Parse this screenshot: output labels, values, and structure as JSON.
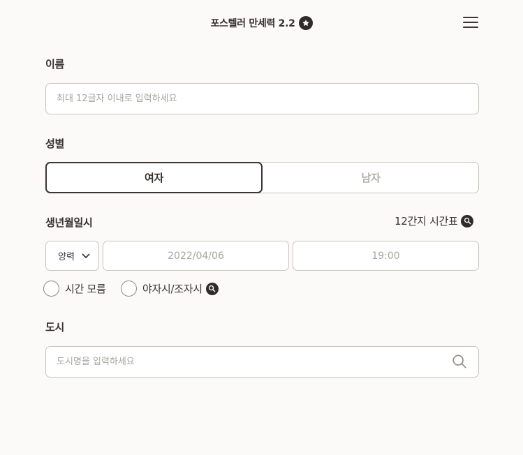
{
  "header": {
    "title": "포스텔러 만세력 2.2"
  },
  "name_field": {
    "label": "이름",
    "placeholder": "최대 12글자 이내로 입력하세요",
    "value": ""
  },
  "gender": {
    "label": "성별",
    "options": [
      "여자",
      "남자"
    ],
    "selected": "여자"
  },
  "birth": {
    "label": "생년월일시",
    "table_link": "12간지 시간표",
    "calendar_type": "양력",
    "date": "2022/04/06",
    "time": "19:00",
    "unknown_time_label": "시간 모름",
    "night_time_label": "야자시/조자시"
  },
  "city": {
    "label": "도시",
    "placeholder": "도시명을 입력하세요",
    "value": ""
  },
  "colors": {
    "background": "#fbfaf8",
    "text": "#35312d",
    "border": "#c9c5c0",
    "muted": "#a9a5a0",
    "badge": "#2f2b28"
  }
}
